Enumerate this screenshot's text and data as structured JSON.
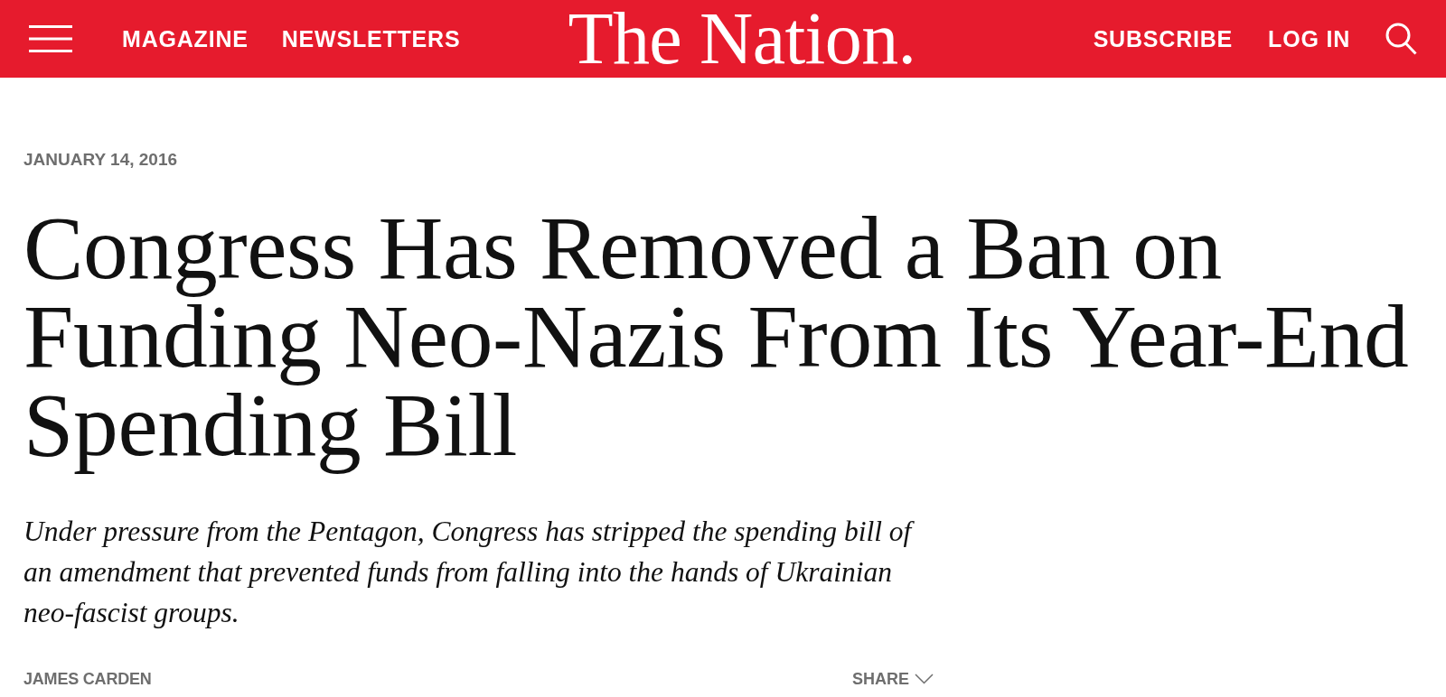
{
  "header": {
    "nav_left": [
      "MAGAZINE",
      "NEWSLETTERS"
    ],
    "logo": "The Nation.",
    "nav_right": [
      "SUBSCRIBE",
      "LOG IN"
    ]
  },
  "article": {
    "date": "JANUARY 14, 2016",
    "headline": "Congress Has Removed a Ban on Funding Neo-Nazis From Its Year-End Spending Bill",
    "dek": "Under pressure from the Pentagon, Congress has stripped the spending bill of an amendment that prevented funds from falling into the hands of Ukrainian neo-fascist groups.",
    "author": "JAMES CARDEN",
    "share": "SHARE"
  }
}
